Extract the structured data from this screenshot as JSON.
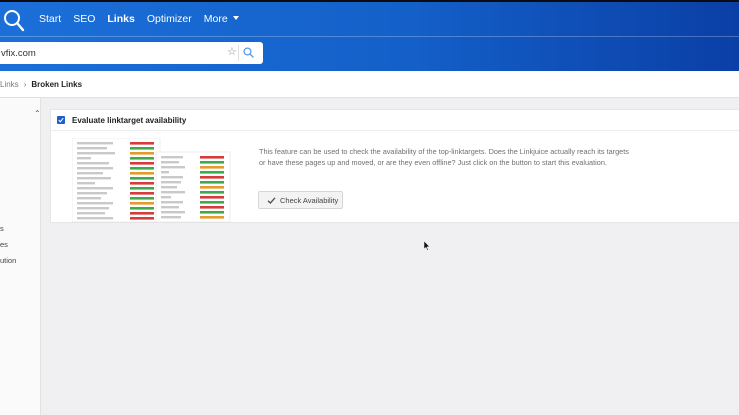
{
  "header": {
    "nav": [
      {
        "label": "Start",
        "active": false
      },
      {
        "label": "SEO",
        "active": false
      },
      {
        "label": "Links",
        "active": true
      },
      {
        "label": "Optimizer",
        "active": false
      },
      {
        "label": "More",
        "active": false
      }
    ],
    "search": {
      "value": "vfix.com"
    }
  },
  "breadcrumb": {
    "parent": "Links",
    "separator": "›",
    "current": "Broken Links"
  },
  "sidebar": {
    "items": [
      "s",
      "es",
      "ution"
    ]
  },
  "card": {
    "checkbox_checked": true,
    "title": "Evaluate linktarget availability",
    "description": "This feature can be used to check the availability of the top-linktargets. Does the Linkjuice actually reach its targets or have these pages up and moved, or are they even offline? Just click on the button to start this evaluation.",
    "button_label": "Check Availability"
  },
  "colors": {
    "brand_blue": "#1460c9",
    "status_red": "#d43b3b",
    "status_green": "#3faa4a",
    "status_orange": "#e59a2f"
  }
}
